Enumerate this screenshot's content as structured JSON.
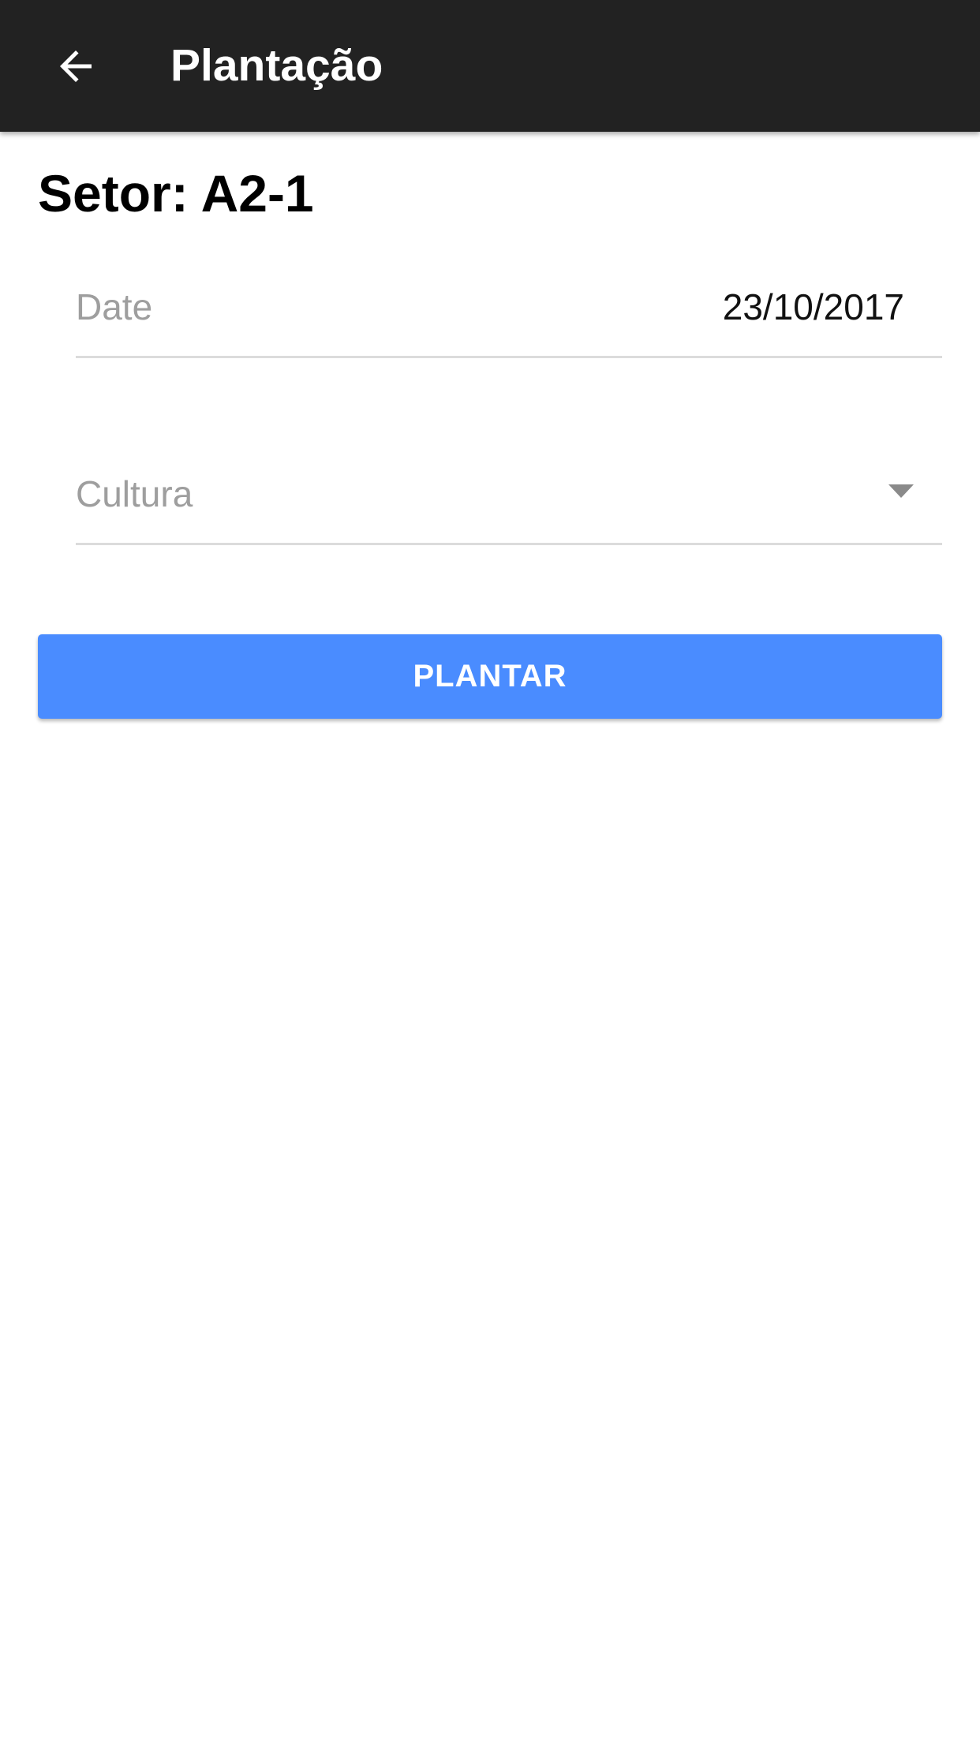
{
  "app_bar": {
    "back_icon": "arrow-back-icon",
    "title": "Plantação",
    "background_color": "#222222"
  },
  "sector": {
    "title": "Setor: A2-1"
  },
  "form": {
    "date": {
      "label": "Date",
      "value": "23/10/2017"
    },
    "cultura": {
      "label": "Cultura",
      "value": "",
      "dropdown_icon": "dropdown-arrow-icon"
    }
  },
  "actions": {
    "plant_label": "PLANTAR",
    "plant_color": "#4a8cff"
  }
}
